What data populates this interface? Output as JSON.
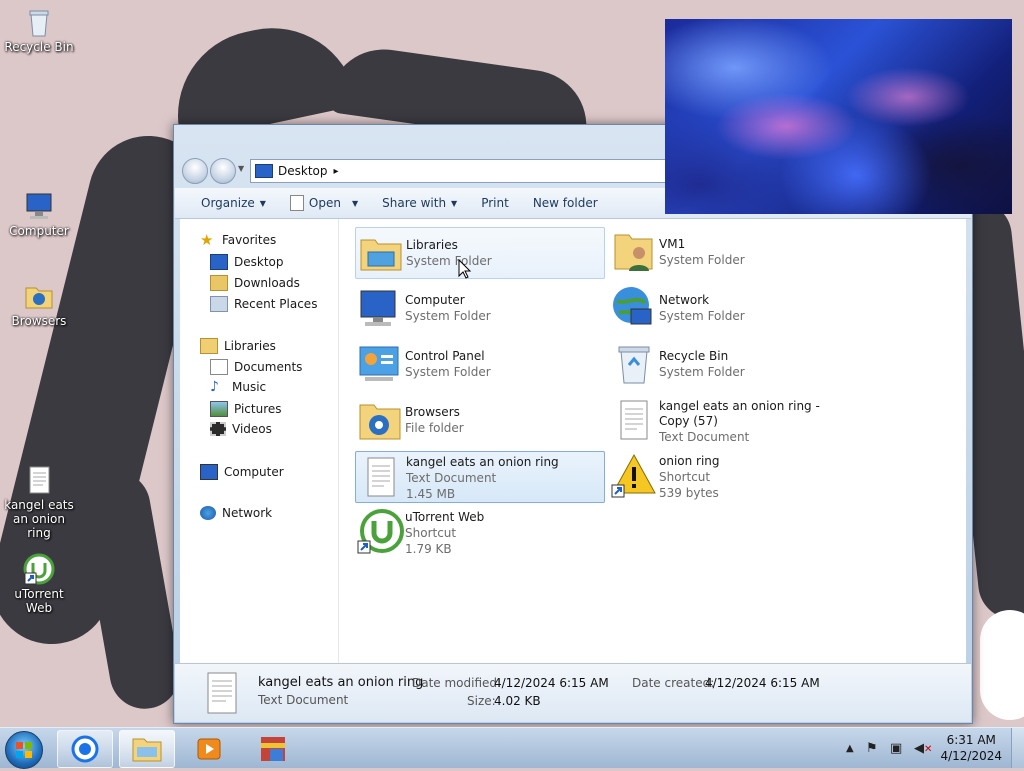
{
  "desktop": {
    "icons": [
      {
        "label": "Recycle Bin",
        "icon": "recycle-bin-icon"
      },
      {
        "label": "Computer",
        "icon": "computer-icon"
      },
      {
        "label": "Browsers",
        "icon": "folder-icon"
      },
      {
        "label": "kangel eats an onion ring",
        "icon": "text-document-icon"
      },
      {
        "label": "uTorrent Web",
        "icon": "utorrent-icon"
      }
    ]
  },
  "window": {
    "address": {
      "location": "Desktop",
      "separator": "▸"
    },
    "toolbar": {
      "organize": "Organize",
      "open": "Open",
      "share_with": "Share with",
      "print": "Print",
      "new_folder": "New folder"
    },
    "nav": {
      "favorites": "Favorites",
      "desktop": "Desktop",
      "downloads": "Downloads",
      "recent_places": "Recent Places",
      "libraries": "Libraries",
      "documents": "Documents",
      "music": "Music",
      "pictures": "Pictures",
      "videos": "Videos",
      "computer": "Computer",
      "network": "Network"
    },
    "files": [
      {
        "name": "Libraries",
        "type": "System Folder",
        "size": "",
        "icon": "libraries-icon",
        "state": "hover"
      },
      {
        "name": "VM1",
        "type": "System Folder",
        "size": "",
        "icon": "user-folder-icon",
        "state": ""
      },
      {
        "name": "Computer",
        "type": "System Folder",
        "size": "",
        "icon": "computer-icon",
        "state": ""
      },
      {
        "name": "Network",
        "type": "System Folder",
        "size": "",
        "icon": "network-icon",
        "state": ""
      },
      {
        "name": "Control Panel",
        "type": "System Folder",
        "size": "",
        "icon": "control-panel-icon",
        "state": ""
      },
      {
        "name": "Recycle Bin",
        "type": "System Folder",
        "size": "",
        "icon": "recycle-bin-icon",
        "state": ""
      },
      {
        "name": "Browsers",
        "type": "File folder",
        "size": "",
        "icon": "folder-icon",
        "state": ""
      },
      {
        "name": "kangel eats an onion ring - Copy (57)",
        "type": "Text Document",
        "size": "",
        "icon": "text-document-icon",
        "state": ""
      },
      {
        "name": "kangel eats an onion ring",
        "type": "Text Document",
        "size": "1.45 MB",
        "icon": "text-document-icon",
        "state": "selected"
      },
      {
        "name": "onion ring",
        "type": "Shortcut",
        "size": "539 bytes",
        "icon": "warning-shortcut-icon",
        "state": ""
      },
      {
        "name": "uTorrent Web",
        "type": "Shortcut",
        "size": "1.79 KB",
        "icon": "utorrent-icon",
        "state": ""
      }
    ],
    "details": {
      "name": "kangel eats an onion ring",
      "type": "Text Document",
      "modified_label": "Date modified:",
      "modified_value": "4/12/2024 6:15 AM",
      "size_label": "Size:",
      "size_value": "4.02 KB",
      "created_label": "Date created:",
      "created_value": "4/12/2024 6:15 AM"
    }
  },
  "taskbar": {
    "pinned": [
      "chrome-icon",
      "explorer-icon",
      "media-player-icon",
      "winrar-icon"
    ],
    "clock": {
      "time": "6:31 AM",
      "date": "4/12/2024"
    }
  }
}
